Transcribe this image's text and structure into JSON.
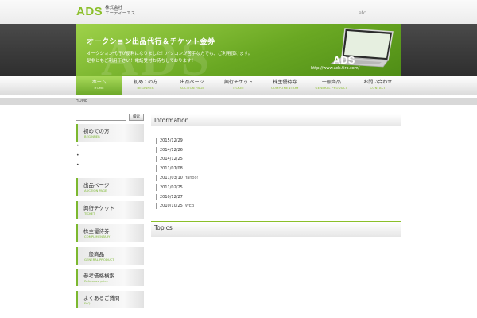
{
  "header": {
    "logo_text": "ADS",
    "company_line1": "株式会社",
    "company_line2": "エーディーエス",
    "etc_link": "etc"
  },
  "hero": {
    "watermark": "ADS",
    "title": "オークション出品代行＆チケット金券",
    "line1": "オークション代行が便利になりました！パソコンが苦手な方でも、ご利用頂けます。",
    "line2": "是非ともご利用下さい！電話受付お待ちしております！",
    "brand": "ADS",
    "url": "http://www.ads.tiro.com/"
  },
  "nav": {
    "items": [
      {
        "jp": "ホーム",
        "en": "HOME",
        "active": true
      },
      {
        "jp": "初めての方",
        "en": "BEGINNER",
        "active": false
      },
      {
        "jp": "出品ページ",
        "en": "AUCTION PAGE",
        "active": false
      },
      {
        "jp": "興行チケット",
        "en": "TICKET",
        "active": false
      },
      {
        "jp": "株主優待券",
        "en": "COMPLIMENTARY",
        "active": false
      },
      {
        "jp": "一般商品",
        "en": "GENERAL PRODUCT",
        "active": false
      },
      {
        "jp": "お問い合わせ",
        "en": "CONTACT",
        "active": false
      }
    ]
  },
  "breadcrumb": {
    "current": "HOME"
  },
  "sidebar": {
    "search": {
      "value": "",
      "button_label": "検索"
    },
    "beginner": {
      "jp": "初めての方",
      "en": "BEGINNER"
    },
    "bullets": [
      "•",
      "•",
      "•"
    ],
    "blocks": [
      {
        "jp": "出品ページ",
        "en": "AUCTION PAGE"
      },
      {
        "jp": "興行チケット",
        "en": "TICKET"
      },
      {
        "jp": "株主優待券",
        "en": "COMPLIMENTARY"
      },
      {
        "jp": "一般商品",
        "en": "GENERAL PRODUCT"
      },
      {
        "jp": "参考価格検索",
        "en": "Reference price"
      },
      {
        "jp": "よくあるご質問",
        "en": "FAQ"
      }
    ]
  },
  "main": {
    "information_title": "Information",
    "information": [
      {
        "date": "2015/12/29",
        "note": ""
      },
      {
        "date": "2014/12/26",
        "note": ""
      },
      {
        "date": "2014/12/25",
        "note": ""
      },
      {
        "date": "2011/07/08",
        "note": ""
      },
      {
        "date": "2011/03/10",
        "note": "Yahoo!"
      },
      {
        "date": "2011/02/25",
        "note": ""
      },
      {
        "date": "2010/12/27",
        "note": ""
      },
      {
        "date": "2010/10/25",
        "note": "WEB"
      }
    ],
    "topics_title": "Topics"
  },
  "colors": {
    "accent": "#8bbf2a",
    "hero_dark": "#3a3a3a"
  }
}
